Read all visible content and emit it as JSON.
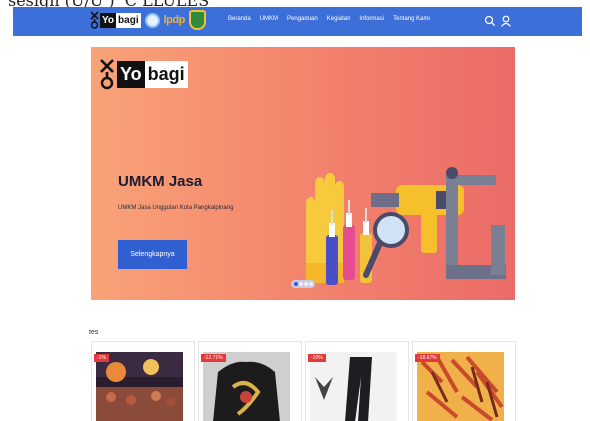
{
  "browser": {
    "title_partial": "sesign (U/U  ) ‘C’LLULES"
  },
  "navbar": {
    "logos": {
      "yobagi_box": "Yo",
      "yobagi_rest": "bagi",
      "lpdp": "lpdp"
    },
    "menu": [
      {
        "label": "Beranda"
      },
      {
        "label": "UMKM"
      },
      {
        "label": "Pengaduan"
      },
      {
        "label": "Kegiatan"
      },
      {
        "label": "Informasi"
      },
      {
        "label": "Tentang Kami"
      }
    ],
    "icons": {
      "search": "search-icon",
      "user": "user-icon"
    },
    "color": "#3d6fd8"
  },
  "hero": {
    "logo_box": "Yo",
    "logo_rest": "bagi",
    "title": "UMKM Jasa",
    "subtitle": "UMKM Jasa Unggulan Kota Pangkalpinang",
    "button": "Selengkapnya",
    "slide_count": 4,
    "active_slide": 1,
    "gradient": [
      "#f8a378",
      "#ea6b67"
    ]
  },
  "products": {
    "section_label": "tes",
    "items": [
      {
        "discount": "-1%"
      },
      {
        "discount": "-12.71%"
      },
      {
        "discount": "-10%"
      },
      {
        "discount": "-18.67%"
      }
    ]
  }
}
